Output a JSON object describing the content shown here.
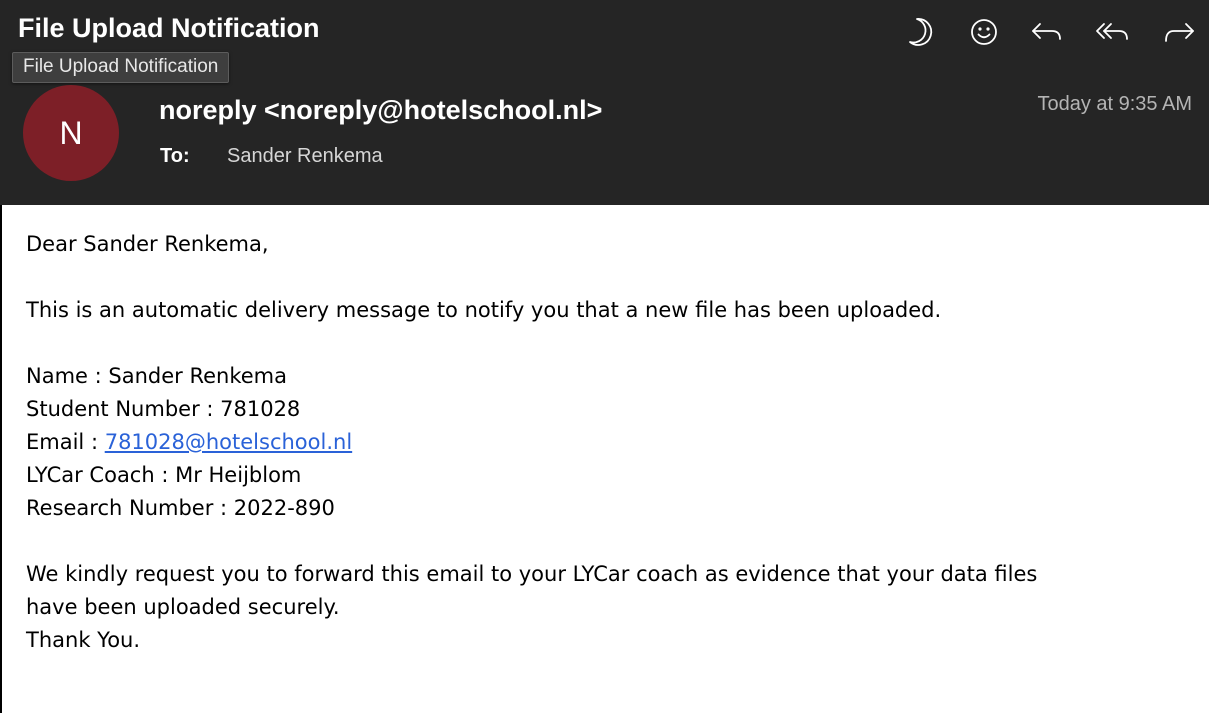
{
  "header": {
    "subject": "File Upload Notification",
    "tooltip": "File Upload Notification",
    "avatar_initial": "N",
    "avatar_color": "#7d1f27",
    "sender": "noreply <noreply@hotelschool.nl>",
    "date": "Today at 9:35 AM",
    "to_label": "To:",
    "to_value": "Sander Renkema",
    "toolbar": [
      {
        "icon": "moon-icon",
        "label": "Snooze"
      },
      {
        "icon": "smiley-icon",
        "label": "Emoji"
      },
      {
        "icon": "reply-icon",
        "label": "Reply"
      },
      {
        "icon": "reply-all-icon",
        "label": "Reply All"
      },
      {
        "icon": "forward-icon",
        "label": "Forward"
      }
    ]
  },
  "body": {
    "greeting": "Dear Sander Renkema,",
    "intro": "This is an automatic delivery message to notify you that a new file has been uploaded.",
    "name_line": "Name : Sander Renkema",
    "student_number_line": "Student Number : 781028",
    "email_prefix": "Email : ",
    "email_link": "781028@hotelschool.nl",
    "coach_line": "LYCar Coach : Mr Heijblom",
    "research_line": "Research Number : 2022-890",
    "request_line1": "We kindly request you to forward this email to your LYCar coach as evidence that your data files",
    "request_line2": "have been uploaded securely.",
    "thanks": "Thank You.",
    "link_color": "#2a62d8"
  }
}
